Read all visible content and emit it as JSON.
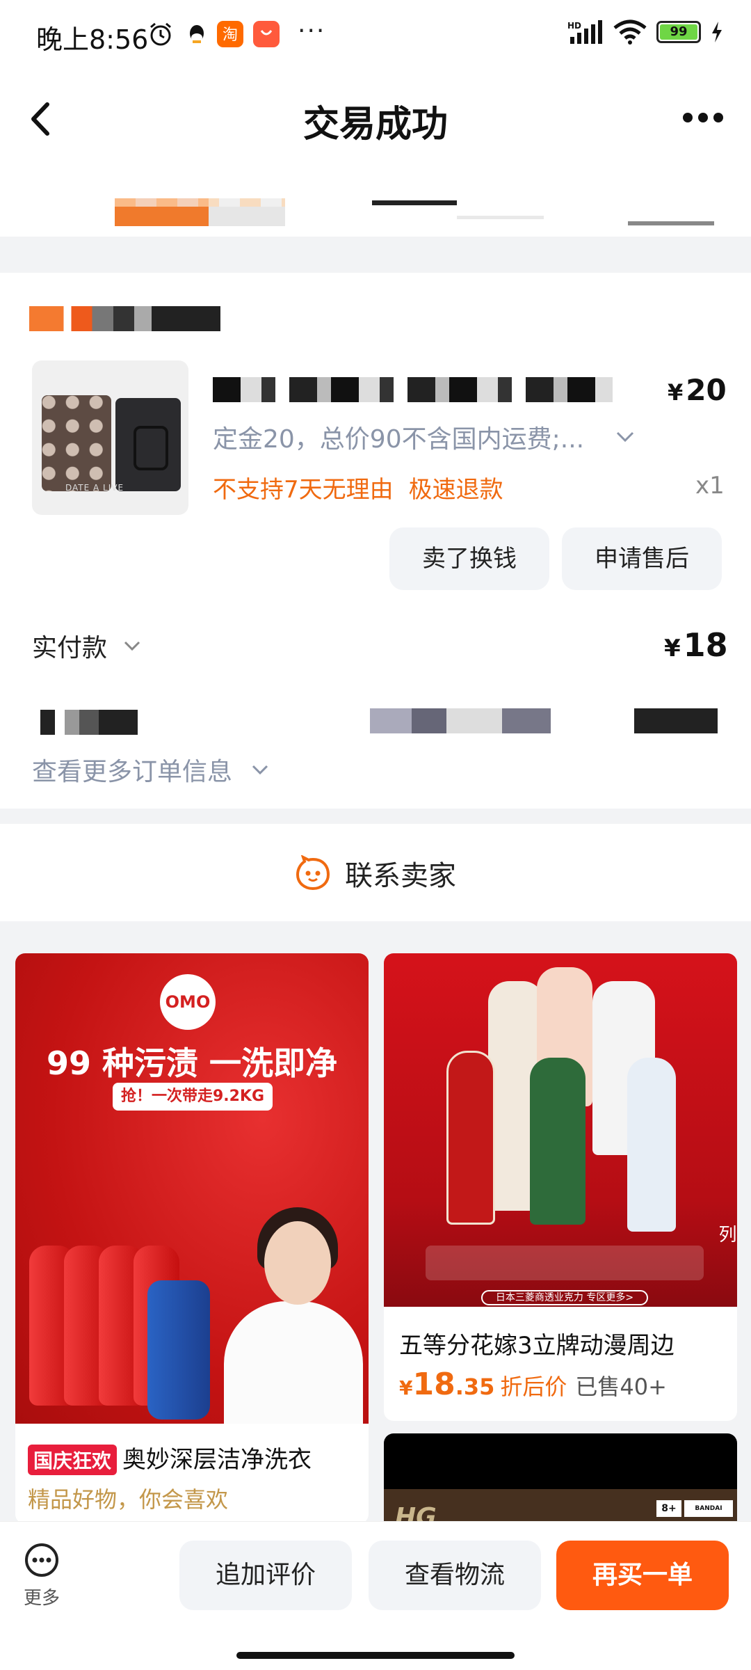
{
  "status_bar": {
    "time": "晚上8:56",
    "dots": "···",
    "network": "HD",
    "battery": "99"
  },
  "header": {
    "title": "交易成功"
  },
  "order": {
    "price_symbol": "¥",
    "price": "20",
    "spec": "定金20，总价90不含国内运费;...",
    "tags": [
      "不支持7天无理由",
      "极速退款"
    ],
    "quantity": "x1",
    "product_img_text": "DATE A LIVE",
    "buttons": {
      "sell": "卖了换钱",
      "after_sale": "申请售后"
    },
    "paid_label": "实付款",
    "paid_symbol": "¥",
    "paid_amount": "18",
    "more_info": "查看更多订单信息"
  },
  "contact": {
    "label": "联系卖家"
  },
  "recommendations": [
    {
      "image_logo": "OMO",
      "image_headline": "99 种污渍 一洗即净",
      "image_sub": "抢！一次带走9.2KG",
      "badge": "国庆狂欢",
      "title": "奥妙深层洁净洗衣",
      "subtitle": "精品好物，你会喜欢"
    },
    {
      "image_side_text": "中式系列",
      "image_footer": "日本三菱商透业克力 专区更多>",
      "title": "五等分花嫁3立牌动漫周边",
      "price_symbol": "¥",
      "price_int": "18",
      "price_dec": ".35",
      "price_tag": "折后价",
      "sold": "已售40+"
    },
    {
      "image_text": "HG",
      "rating": "8+",
      "brand": "BANDAI NAMCO"
    }
  ],
  "bottom_bar": {
    "more": "更多",
    "add_review": "追加评价",
    "track": "查看物流",
    "rebuy": "再买一单"
  },
  "colors": {
    "accent": "#ff5a10",
    "tag_orange": "#f06a10",
    "muted": "#8a94a8",
    "badge_red": "#e81e3c"
  }
}
